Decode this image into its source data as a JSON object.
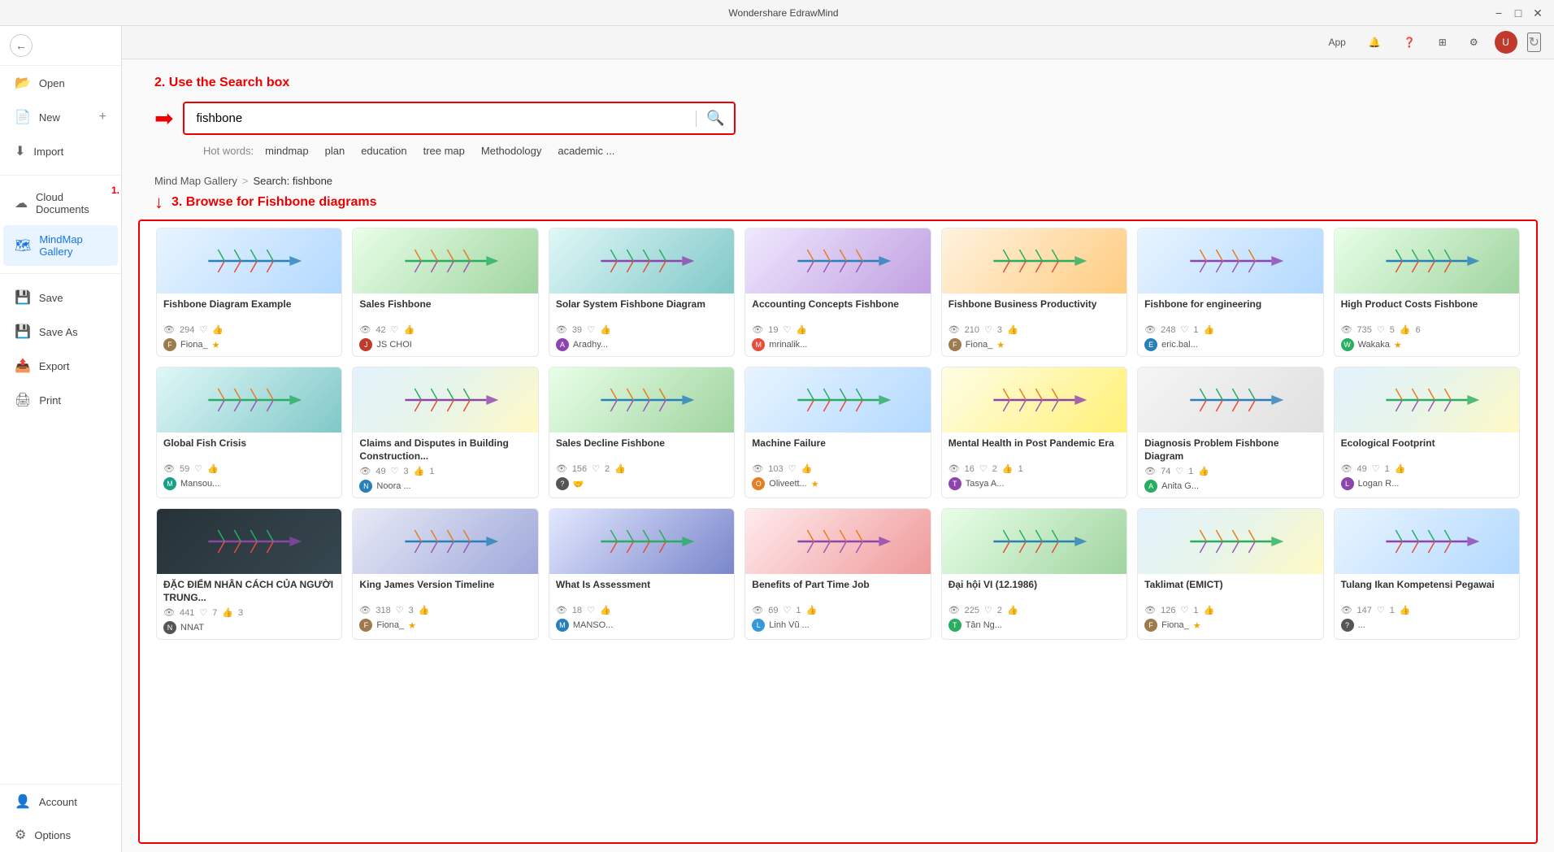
{
  "titleBar": {
    "title": "Wondershare EdrawMind",
    "minBtn": "−",
    "maxBtn": "□",
    "closeBtn": "✕"
  },
  "toolbar": {
    "appLabel": "App",
    "bellIcon": "🔔",
    "helpIcon": "?",
    "gridIcon": "⊞",
    "settingsIcon": "⚙"
  },
  "sidebar": {
    "backBtn": "←",
    "items": [
      {
        "id": "open",
        "label": "Open",
        "icon": "📂"
      },
      {
        "id": "new",
        "label": "New",
        "icon": "📄",
        "hasPlus": true
      },
      {
        "id": "import",
        "label": "Import",
        "icon": "⬇"
      },
      {
        "id": "cloud",
        "label": "Cloud Documents",
        "icon": "☁",
        "hasStep": "1."
      },
      {
        "id": "mindmap",
        "label": "MindMap Gallery",
        "icon": "🗺",
        "active": true
      },
      {
        "id": "save",
        "label": "Save",
        "icon": "💾"
      },
      {
        "id": "saveas",
        "label": "Save As",
        "icon": "💾"
      },
      {
        "id": "export",
        "label": "Export",
        "icon": "📤"
      },
      {
        "id": "print",
        "label": "Print",
        "icon": "🖨"
      }
    ],
    "bottomItems": [
      {
        "id": "account",
        "label": "Account",
        "icon": "👤"
      },
      {
        "id": "options",
        "label": "Options",
        "icon": "⚙"
      }
    ]
  },
  "annotations": {
    "step2": "2. Use the Search box",
    "step3": "3. Browse for Fishbone diagrams"
  },
  "search": {
    "value": "fishbone",
    "placeholder": "fishbone",
    "hotWordsLabel": "Hot words:",
    "hotWords": [
      "mindmap",
      "plan",
      "education",
      "tree map",
      "Methodology",
      "academic ..."
    ]
  },
  "breadcrumb": {
    "gallery": "Mind Map Gallery",
    "separator": ">",
    "current": "Search:  fishbone"
  },
  "gallery": {
    "cards": [
      {
        "title": "Fishbone Diagram Example",
        "thumbClass": "thumb-blue",
        "views": "294",
        "likes": "",
        "comments": "",
        "author": "Fiona_",
        "authorColor": "#9c7b4e",
        "hasBadge": true
      },
      {
        "title": "Sales Fishbone",
        "thumbClass": "thumb-green",
        "views": "42",
        "likes": "",
        "comments": "",
        "author": "JS CHOI",
        "authorColor": "#c0392b",
        "hasBadge": false
      },
      {
        "title": "Solar System Fishbone Diagram",
        "thumbClass": "thumb-teal",
        "views": "39",
        "likes": "",
        "comments": "",
        "author": "Aradhy...",
        "authorColor": "#8e44ad",
        "hasBadge": false
      },
      {
        "title": "Accounting Concepts Fishbone",
        "thumbClass": "thumb-purple",
        "views": "19",
        "likes": "",
        "comments": "",
        "author": "mrinalik...",
        "authorColor": "#e74c3c",
        "hasBadge": false
      },
      {
        "title": "Fishbone Business Productivity",
        "thumbClass": "thumb-orange",
        "views": "210",
        "likes": "3",
        "comments": "",
        "author": "Fiona_",
        "authorColor": "#9c7b4e",
        "hasBadge": true
      },
      {
        "title": "Fishbone for engineering",
        "thumbClass": "thumb-blue",
        "views": "248",
        "likes": "1",
        "comments": "",
        "author": "eric.bal...",
        "authorColor": "#2980b9",
        "hasBadge": false
      },
      {
        "title": "High Product Costs Fishbone",
        "thumbClass": "thumb-green",
        "views": "735",
        "likes": "5",
        "comments": "6",
        "author": "Wakaka",
        "authorColor": "#27ae60",
        "hasBadge": true
      },
      {
        "title": "Global Fish Crisis",
        "thumbClass": "thumb-teal",
        "views": "59",
        "likes": "",
        "comments": "",
        "author": "Mansou...",
        "authorColor": "#16a085",
        "hasBadge": false
      },
      {
        "title": "Claims and Disputes in Building Construction...",
        "thumbClass": "thumb-multi",
        "views": "49",
        "likes": "3",
        "comments": "1",
        "author": "Noora ...",
        "authorColor": "#2980b9",
        "hasBadge": false
      },
      {
        "title": "Sales Decline Fishbone",
        "thumbClass": "thumb-green",
        "views": "156",
        "likes": "2",
        "comments": "",
        "author": "🤝",
        "authorColor": "#555",
        "hasBadge": false
      },
      {
        "title": "Machine Failure",
        "thumbClass": "thumb-blue",
        "views": "103",
        "likes": "",
        "comments": "",
        "author": "Oliveett...",
        "authorColor": "#e67e22",
        "hasBadge": true
      },
      {
        "title": "Mental Health in Post Pandemic Era",
        "thumbClass": "thumb-yellow",
        "views": "16",
        "likes": "2",
        "comments": "1",
        "author": "Tasya A...",
        "authorColor": "#8e44ad",
        "hasBadge": false
      },
      {
        "title": "Diagnosis Problem Fishbone Diagram",
        "thumbClass": "thumb-gray",
        "views": "74",
        "likes": "1",
        "comments": "",
        "author": "Anita G...",
        "authorColor": "#27ae60",
        "hasBadge": false
      },
      {
        "title": "Ecological Footprint",
        "thumbClass": "thumb-multi",
        "views": "49",
        "likes": "1",
        "comments": "",
        "author": "Logan R...",
        "authorColor": "#8e44ad",
        "hasBadge": false
      },
      {
        "title": "ĐẶC ĐIỂM NHÂN CÁCH CỦA NGƯỜI TRUNG...",
        "thumbClass": "thumb-dark",
        "views": "441",
        "likes": "7",
        "comments": "3",
        "author": "NNAT",
        "authorColor": "#555",
        "hasBadge": false
      },
      {
        "title": "King James Version Timeline",
        "thumbClass": "thumb-indigo",
        "views": "318",
        "likes": "3",
        "comments": "",
        "author": "Fiona_",
        "authorColor": "#9c7b4e",
        "hasBadge": true
      },
      {
        "title": "What Is Assessment",
        "thumbClass": "thumb-navy",
        "views": "18",
        "likes": "",
        "comments": "",
        "author": "MANSO...",
        "authorColor": "#2980b9",
        "hasBadge": false
      },
      {
        "title": "Benefits of Part Time Job",
        "thumbClass": "thumb-red",
        "views": "69",
        "likes": "1",
        "comments": "",
        "author": "Linh Vũ ...",
        "authorColor": "#3498db",
        "hasBadge": false
      },
      {
        "title": "Đại hội VI (12.1986)",
        "thumbClass": "thumb-green",
        "views": "225",
        "likes": "2",
        "comments": "",
        "author": "Tân Ng...",
        "authorColor": "#27ae60",
        "hasBadge": false
      },
      {
        "title": "Taklimat (EMICT)",
        "thumbClass": "thumb-multi",
        "views": "126",
        "likes": "1",
        "comments": "",
        "author": "Fiona_",
        "authorColor": "#9c7b4e",
        "hasBadge": true
      },
      {
        "title": "Tulang Ikan Kompetensi Pegawai",
        "thumbClass": "thumb-blue",
        "views": "147",
        "likes": "1",
        "comments": "",
        "author": "...",
        "authorColor": "#555",
        "hasBadge": false
      }
    ]
  }
}
